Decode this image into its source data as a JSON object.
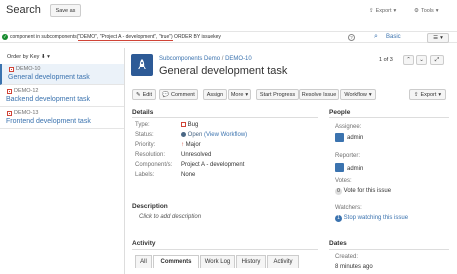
{
  "header": {
    "title": "Search",
    "save_as": "Save as",
    "export": "Export",
    "tools": "Tools"
  },
  "jql": {
    "prefix": "component in subcomponents(",
    "args": "\"DEMO\", \"Project A - development\", \"true\")",
    "suffix": " ORDER BY issuekey",
    "basic": "Basic"
  },
  "left": {
    "order_by": "Order by Key",
    "issues": [
      {
        "key": "DEMO-10",
        "summary": "General development task"
      },
      {
        "key": "DEMO-12",
        "summary": "Backend development task"
      },
      {
        "key": "DEMO-13",
        "summary": "Frontend development task"
      }
    ]
  },
  "issue": {
    "breadcrumb_project": "Subcomponents Demo",
    "breadcrumb_sep": " / ",
    "breadcrumb_key": "DEMO-10",
    "title": "General development task",
    "pager": "1 of 3"
  },
  "toolbar": {
    "edit": "Edit",
    "comment": "Comment",
    "assign": "Assign",
    "more": "More",
    "start_progress": "Start Progress",
    "resolve": "Resolve Issue",
    "workflow": "Workflow",
    "export": "Export"
  },
  "details": {
    "heading": "Details",
    "type_lbl": "Type:",
    "type_val": "Bug",
    "status_lbl": "Status:",
    "status_val": "Open",
    "status_link": "(View Workflow)",
    "priority_lbl": "Priority:",
    "priority_val": "Major",
    "resolution_lbl": "Resolution:",
    "resolution_val": "Unresolved",
    "components_lbl": "Component/s:",
    "components_val": "Project A - development",
    "labels_lbl": "Labels:",
    "labels_val": "None"
  },
  "description": {
    "heading": "Description",
    "placeholder": "Click to add description"
  },
  "activity": {
    "heading": "Activity",
    "tabs": [
      "All",
      "Comments",
      "Work Log",
      "History",
      "Activity"
    ]
  },
  "people": {
    "heading": "People",
    "assignee_lbl": "Assignee:",
    "assignee_val": "admin",
    "reporter_lbl": "Reporter:",
    "reporter_val": "admin",
    "votes_lbl": "Votes:",
    "votes_val": "0",
    "vote_link": "Vote for this issue",
    "watchers_lbl": "Watchers:",
    "watchers_val": "1",
    "watch_link": "Stop watching this issue"
  },
  "dates": {
    "heading": "Dates",
    "created_lbl": "Created:",
    "created_val": "8 minutes ago"
  },
  "colors": {
    "accent": "#3b73af",
    "bug": "#d04437",
    "open": "#4a6785"
  }
}
